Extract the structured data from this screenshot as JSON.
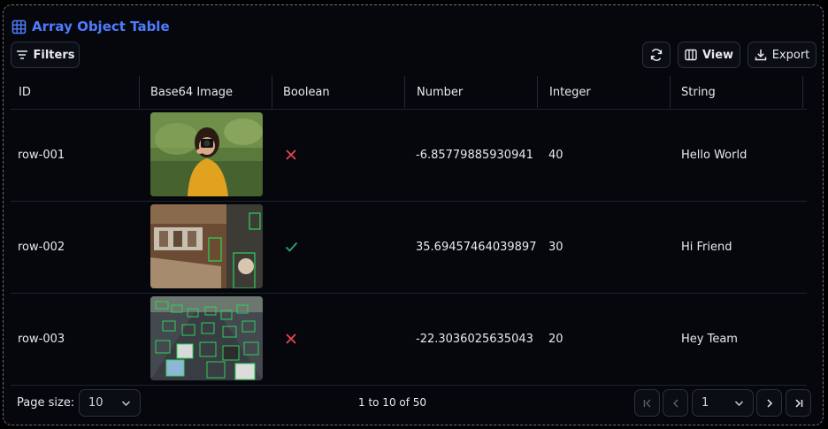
{
  "title": "Array Object Table",
  "toolbar": {
    "filters_label": "Filters",
    "view_label": "View",
    "export_label": "Export"
  },
  "columns": [
    "ID",
    "Base64 Image",
    "Boolean",
    "Number",
    "Integer",
    "String"
  ],
  "rows": [
    {
      "id": "row-001",
      "image": "woman with camera",
      "boolean": "false",
      "number": "-6.85779885930941",
      "integer": "40",
      "string": "Hello World"
    },
    {
      "id": "row-002",
      "image": "cafe interior detection",
      "boolean": "true",
      "number": "35.69457464039897",
      "integer": "30",
      "string": "Hi Friend"
    },
    {
      "id": "row-003",
      "image": "traffic detection",
      "boolean": "false",
      "number": "-22.3036025635043",
      "integer": "20",
      "string": "Hey Team"
    }
  ],
  "footer": {
    "page_size_label": "Page size:",
    "page_size_value": "10",
    "range_text": "1 to 10 of 50",
    "page_value": "1"
  },
  "colors": {
    "accent": "#4f7cff",
    "false_mark": "#e5484d",
    "true_mark": "#30a46c"
  }
}
